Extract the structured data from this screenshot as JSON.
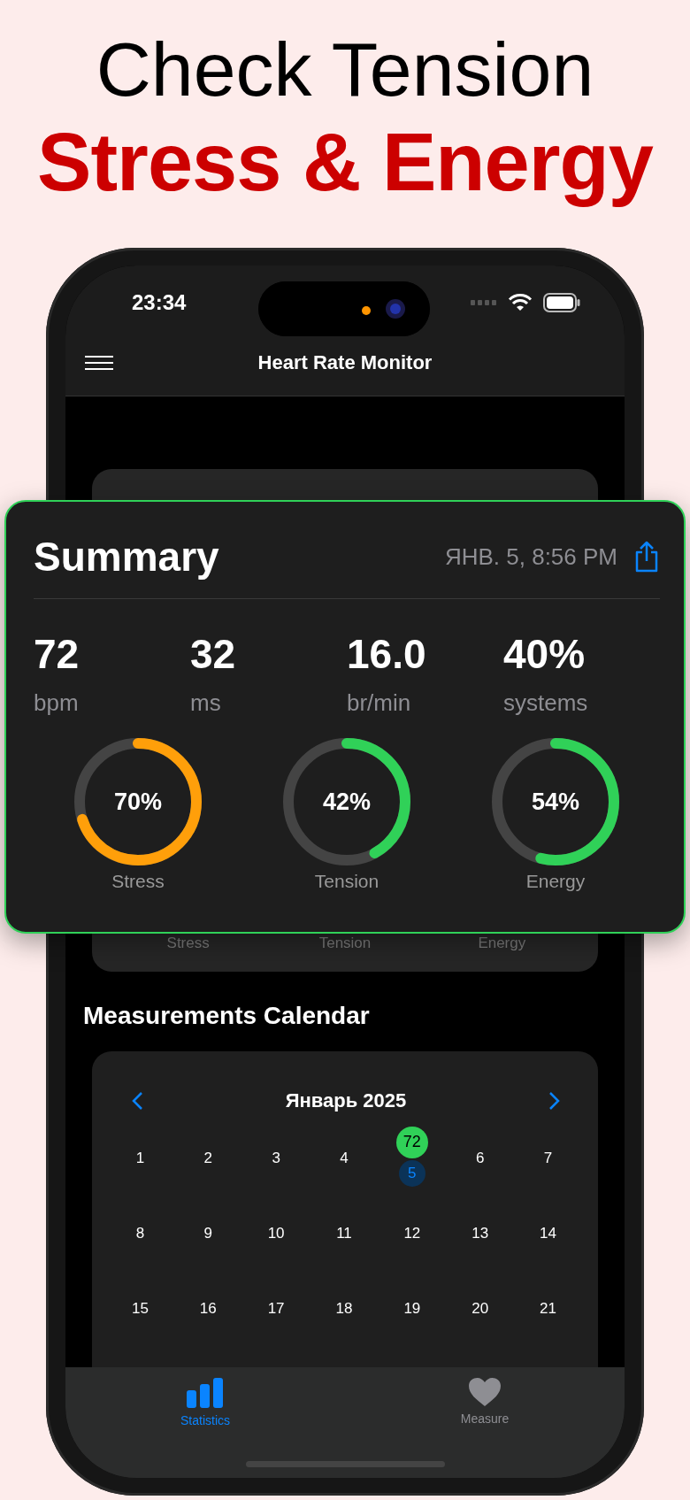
{
  "headline": {
    "line_1": "Check Tension",
    "line_2": "Stress & Energy"
  },
  "status_bar": {
    "time": "23:34"
  },
  "nav_bar": {
    "title": "Heart Rate Monitor"
  },
  "background_card": {
    "labels": [
      "Stress",
      "Tension",
      "Energy"
    ]
  },
  "summary": {
    "title": "Summary",
    "date": "ЯНВ. 5, 8:56 PM",
    "stats": [
      {
        "value": "72",
        "unit": "bpm"
      },
      {
        "value": "32",
        "unit": "ms"
      },
      {
        "value": "16.0",
        "unit": "br/min"
      },
      {
        "value": "40%",
        "unit": "systems"
      }
    ],
    "rings": [
      {
        "value": "70%",
        "label": "Stress",
        "level": 0.7,
        "color": "#ff9f0a"
      },
      {
        "value": "42%",
        "label": "Tension",
        "level": 0.42,
        "color": "#30d158"
      },
      {
        "value": "54%",
        "label": "Energy",
        "level": 0.54,
        "color": "#30d158"
      }
    ]
  },
  "calendar": {
    "heading": "Measurements Calendar",
    "month": "Январь 2025",
    "weeks": [
      [
        {
          "day": "1",
          "selected": false
        },
        {
          "day": "2",
          "selected": false
        },
        {
          "day": "3",
          "selected": false
        },
        {
          "day": "4",
          "selected": false
        },
        {
          "day": "5",
          "selected": true,
          "badge": "72"
        },
        {
          "day": "6",
          "selected": false
        },
        {
          "day": "7",
          "selected": false
        }
      ],
      [
        {
          "day": "8",
          "selected": false
        },
        {
          "day": "9",
          "selected": false
        },
        {
          "day": "10",
          "selected": false
        },
        {
          "day": "11",
          "selected": false
        },
        {
          "day": "12",
          "selected": false
        },
        {
          "day": "13",
          "selected": false
        },
        {
          "day": "14",
          "selected": false
        }
      ],
      [
        {
          "day": "15",
          "selected": false
        },
        {
          "day": "16",
          "selected": false
        },
        {
          "day": "17",
          "selected": false
        },
        {
          "day": "18",
          "selected": false
        },
        {
          "day": "19",
          "selected": false
        },
        {
          "day": "20",
          "selected": false
        },
        {
          "day": "21",
          "selected": false
        }
      ]
    ]
  },
  "tab_bar": {
    "tabs": [
      {
        "label": "Statistics",
        "selected": true
      },
      {
        "label": "Measure",
        "selected": false
      }
    ]
  }
}
